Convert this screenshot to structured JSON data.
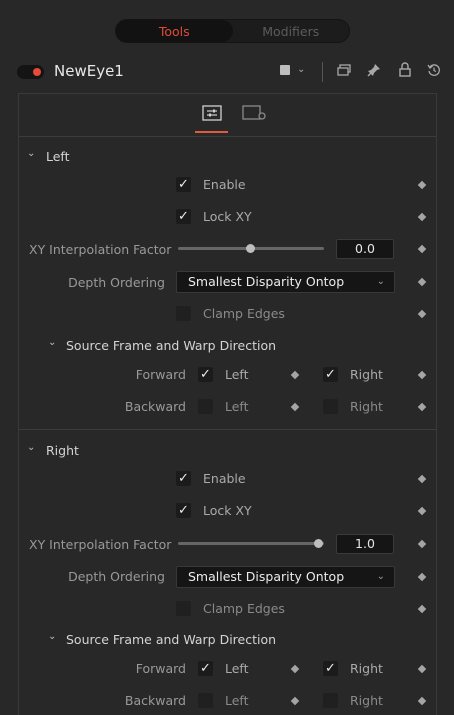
{
  "tabs": [
    {
      "label": "Tools",
      "active": true
    },
    {
      "label": "Modifiers",
      "active": false
    }
  ],
  "header": {
    "tool_name": "NewEye1",
    "icons": [
      "color-square-icon",
      "chevron-down-icon",
      "copy-icon",
      "pin-icon",
      "lock-icon",
      "reset-icon"
    ]
  },
  "subtabs": [
    "controls-icon",
    "settings-icon"
  ],
  "sections": [
    {
      "title": "Left",
      "enable": {
        "label": "Enable",
        "checked": true
      },
      "lock_xy": {
        "label": "Lock XY",
        "checked": true
      },
      "xy_interp": {
        "label": "XY Interpolation Factor",
        "value": "0.0",
        "fraction": 0.5
      },
      "depth_ordering": {
        "label": "Depth Ordering",
        "value": "Smallest Disparity Ontop"
      },
      "clamp_edges": {
        "label": "Clamp Edges",
        "checked": false
      },
      "source_frame": {
        "title": "Source Frame and Warp Direction",
        "forward": {
          "label": "Forward",
          "left": {
            "label": "Left",
            "checked": true
          },
          "right": {
            "label": "Right",
            "checked": true
          }
        },
        "backward": {
          "label": "Backward",
          "left": {
            "label": "Left",
            "checked": false
          },
          "right": {
            "label": "Right",
            "checked": false
          }
        }
      }
    },
    {
      "title": "Right",
      "enable": {
        "label": "Enable",
        "checked": true
      },
      "lock_xy": {
        "label": "Lock XY",
        "checked": true
      },
      "xy_interp": {
        "label": "XY Interpolation Factor",
        "value": "1.0",
        "fraction": 1.0
      },
      "depth_ordering": {
        "label": "Depth Ordering",
        "value": "Smallest Disparity Ontop"
      },
      "clamp_edges": {
        "label": "Clamp Edges",
        "checked": false
      },
      "source_frame": {
        "title": "Source Frame and Warp Direction",
        "forward": {
          "label": "Forward",
          "left": {
            "label": "Left",
            "checked": true
          },
          "right": {
            "label": "Right",
            "checked": true
          }
        },
        "backward": {
          "label": "Backward",
          "left": {
            "label": "Left",
            "checked": false
          },
          "right": {
            "label": "Right",
            "checked": false
          }
        }
      }
    }
  ],
  "glyphs": {
    "check": "✓",
    "chevron": "⌄"
  },
  "colors": {
    "accent": "#e04a3a",
    "background": "#282828",
    "field": "#151515"
  }
}
